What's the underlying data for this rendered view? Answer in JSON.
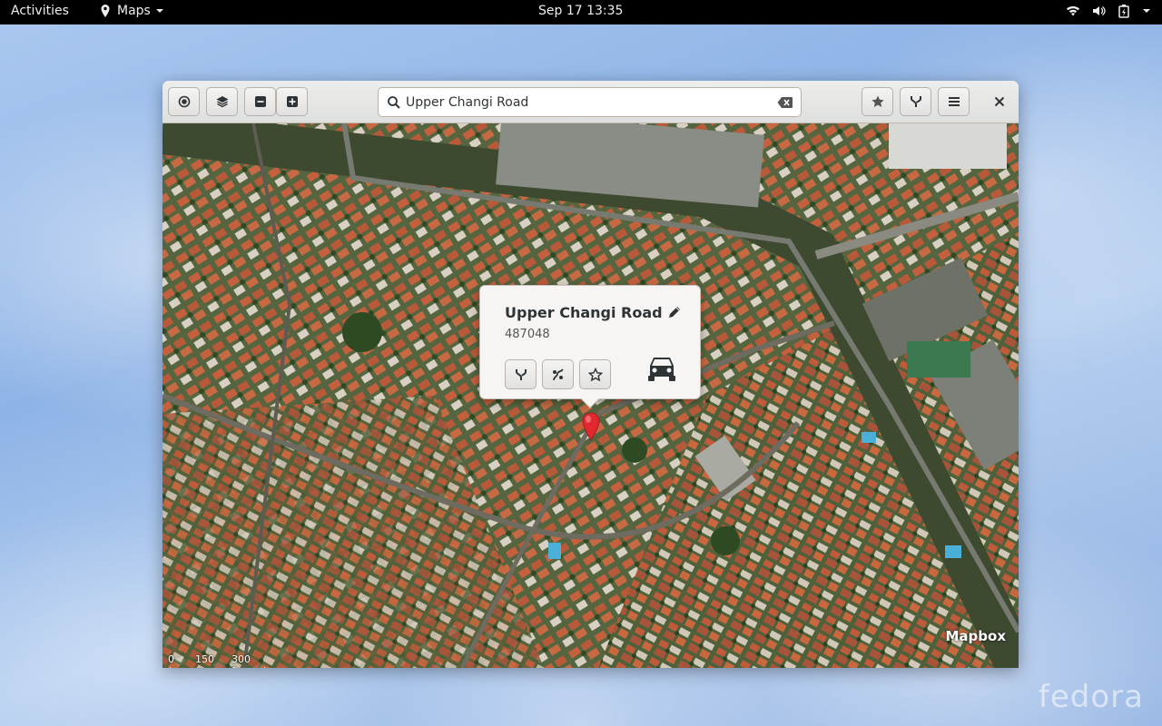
{
  "topbar": {
    "activities": "Activities",
    "app_name": "Maps",
    "clock": "Sep 17  13:35",
    "icons": [
      "map-pin-icon",
      "wifi-icon",
      "volume-icon",
      "battery-icon",
      "chevron-down-icon"
    ]
  },
  "window": {
    "search": {
      "value": "Upper Changi Road",
      "placeholder": ""
    },
    "header_buttons": [
      "locate-icon",
      "layers-icon",
      "zoom-out-icon",
      "zoom-in-icon",
      "star-icon",
      "route-icon",
      "menu-icon",
      "close-icon"
    ]
  },
  "popover": {
    "title": "Upper Changi Road",
    "subtitle": "487048",
    "buttons": [
      "route-icon",
      "route-waypoint-icon",
      "favorite-star-icon"
    ],
    "transport_icon": "car-icon"
  },
  "map": {
    "attribution": "Mapbox",
    "scale_labels": [
      "0",
      "150",
      "300 ft"
    ]
  },
  "desktop": {
    "logo_text": "fedora"
  },
  "colors": {
    "accent_marker": "#e0282e",
    "topbar_bg": "#000000",
    "headerbar_bg": "#e8e8e7"
  }
}
